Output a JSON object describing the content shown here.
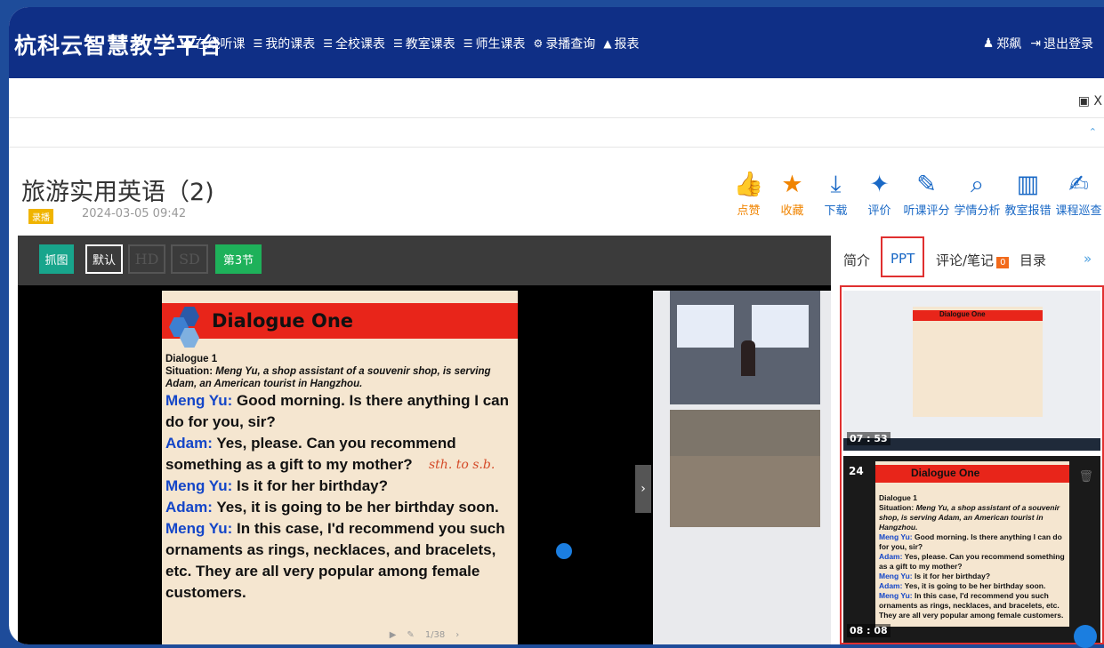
{
  "header": {
    "brand": "杭科云智慧教学平台",
    "nav": [
      {
        "icon": "record-icon",
        "label": "在线听课"
      },
      {
        "icon": "list-icon",
        "label": "我的课表"
      },
      {
        "icon": "list-icon",
        "label": "全校课表"
      },
      {
        "icon": "list-icon",
        "label": "教室课表"
      },
      {
        "icon": "list-icon",
        "label": "师生课表"
      },
      {
        "icon": "gear-icon",
        "label": "录播查询"
      },
      {
        "icon": "chart-icon",
        "label": "报表"
      }
    ],
    "user": "郑飙",
    "logout": "退出登录"
  },
  "window": {
    "close": "X"
  },
  "course": {
    "title": "旅游实用英语（2)",
    "badge": "录播",
    "datetime": "2024-03-05 09:42"
  },
  "actions": [
    {
      "icon": "thumbs-up-icon",
      "label": "点赞",
      "color": "#f08400"
    },
    {
      "icon": "star-icon",
      "label": "收藏",
      "color": "#f08400"
    },
    {
      "icon": "download-icon",
      "label": "下载",
      "color": "#1a69c6"
    },
    {
      "icon": "sparkle-star-icon",
      "label": "评价",
      "color": "#1a69c6"
    },
    {
      "icon": "rate-icon",
      "label": "听课评分",
      "color": "#1a69c6"
    },
    {
      "icon": "analysis-icon",
      "label": "学情分析",
      "color": "#1a69c6"
    },
    {
      "icon": "building-icon",
      "label": "教室报错",
      "color": "#1a69c6"
    },
    {
      "icon": "edit-icon",
      "label": "课程巡查",
      "color": "#1a69c6"
    }
  ],
  "player": {
    "capture": "抓图",
    "default": "默认",
    "hd": "HD",
    "sd": "SD",
    "section": "第3节",
    "page_indicator": "1/38"
  },
  "slide": {
    "title": "Dialogue One",
    "heading": "Dialogue 1",
    "situation_label": "Situation:",
    "situation_text": "Meng Yu, a shop assistant of a souvenir shop, is serving Adam, an American tourist in Hangzhou.",
    "lines": [
      {
        "speaker": "Meng Yu:",
        "text": "Good morning. Is there anything I can do for you, sir?"
      },
      {
        "speaker": "Adam:",
        "text": "Yes, please. Can you recommend something as a gift to my mother?"
      },
      {
        "speaker": "Meng Yu:",
        "text": "Is it for her birthday?"
      },
      {
        "speaker": "Adam:",
        "text": "Yes, it is going to be her birthday soon."
      },
      {
        "speaker": "Meng Yu:",
        "text": "In this case, I'd recommend you such ornaments as rings, necklaces, and bracelets, etc. They are all very popular among female customers."
      }
    ],
    "annotation": "sth. to s.b."
  },
  "side": {
    "tabs": [
      "简介",
      "PPT",
      "评论/笔记",
      "目录"
    ],
    "comment_count": "0",
    "active_tab": "PPT",
    "thumbs": [
      {
        "time": "07 : 53"
      },
      {
        "number": "24",
        "time": "08 : 08"
      }
    ]
  }
}
